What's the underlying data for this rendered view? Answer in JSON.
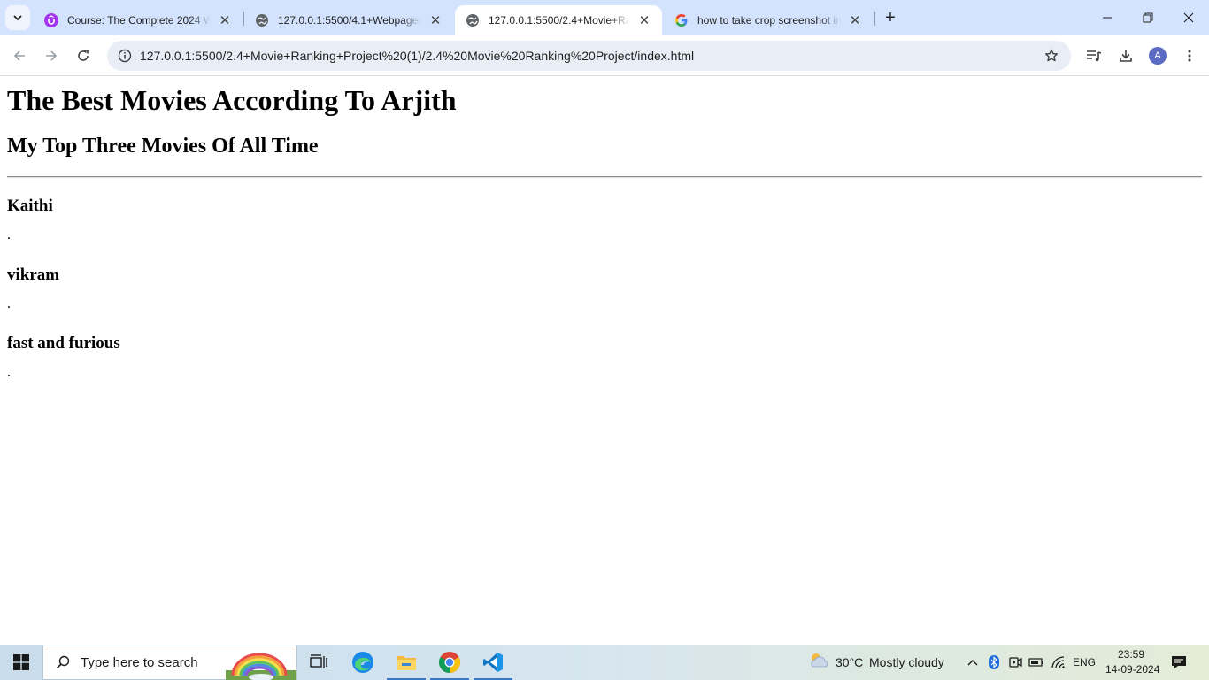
{
  "browser": {
    "tabs": [
      {
        "title": "Course: The Complete 2024 Web Development Bootcamp",
        "favicon": "udemy-icon",
        "active": false
      },
      {
        "title": "127.0.0.1:5500/4.1+Webpages/index.html",
        "favicon": "globe-icon",
        "active": false
      },
      {
        "title": "127.0.0.1:5500/2.4+Movie+Ranking",
        "favicon": "globe-icon",
        "active": true
      },
      {
        "title": "how to take crop screenshot in windows",
        "favicon": "google-icon",
        "active": false
      }
    ],
    "address": "127.0.0.1:5500/2.4+Movie+Ranking+Project%20(1)/2.4%20Movie%20Ranking%20Project/index.html",
    "profile_initial": "A",
    "accent": "#d3e3fd"
  },
  "page": {
    "heading": "The Best Movies According To Arjith",
    "subheading": "My Top Three Movies Of All Time",
    "movies": [
      {
        "title": "Kaithi",
        "description": "."
      },
      {
        "title": "vikram",
        "description": "."
      },
      {
        "title": "fast and furious",
        "description": "."
      }
    ]
  },
  "taskbar": {
    "search_placeholder": "Type here to search",
    "weather": {
      "temp": "30°C",
      "condition": "Mostly cloudy"
    },
    "language": "ENG",
    "time": "23:59",
    "date": "14-09-2024"
  }
}
